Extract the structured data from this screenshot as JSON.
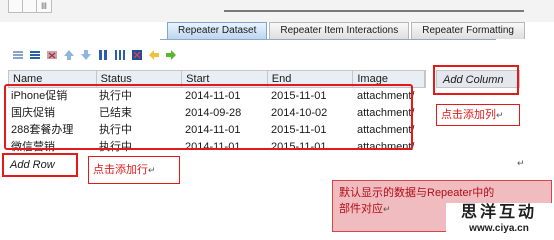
{
  "tabs": [
    "Repeater Dataset",
    "Repeater Item Interactions",
    "Repeater Formatting"
  ],
  "active_tab": 0,
  "toolbar_icons": [
    "add-row-icon",
    "insert-row-icon",
    "delete-row-icon",
    "move-up-icon",
    "move-down-icon",
    "add-column-icon",
    "insert-column-icon",
    "delete-column-icon",
    "move-left-icon",
    "move-right-icon"
  ],
  "grid": {
    "columns": [
      "Name",
      "Status",
      "Start",
      "End",
      "Image"
    ],
    "rows": [
      [
        "iPhone促销",
        "执行中",
        "2014-11-01",
        "2015-11-01",
        "attachment/"
      ],
      [
        "国庆促销",
        "已结束",
        "2014-09-28",
        "2014-10-02",
        "attachment/"
      ],
      [
        "288套餐办理",
        "执行中",
        "2014-11-01",
        "2015-11-01",
        "attachment/"
      ],
      [
        "微信营销",
        "执行中",
        "2014-11-01",
        "2015-11-01",
        "attachment/"
      ]
    ],
    "add_column": "Add Column",
    "add_row": "Add Row"
  },
  "annotations": {
    "add_column_note": "点击添加列",
    "add_row_note": "点击添加行",
    "dataset_note_line1": "默认显示的数据与Repeater中的",
    "dataset_note_line2": "部件对应"
  },
  "paragraph_mark": "↵",
  "watermark": {
    "title": "思洋互动",
    "url": "www.ciya.cn"
  },
  "colors": {
    "highlight": "#e21a1a",
    "callout_fill": "#f0bcc0",
    "header_fill": "#e9eef5"
  }
}
